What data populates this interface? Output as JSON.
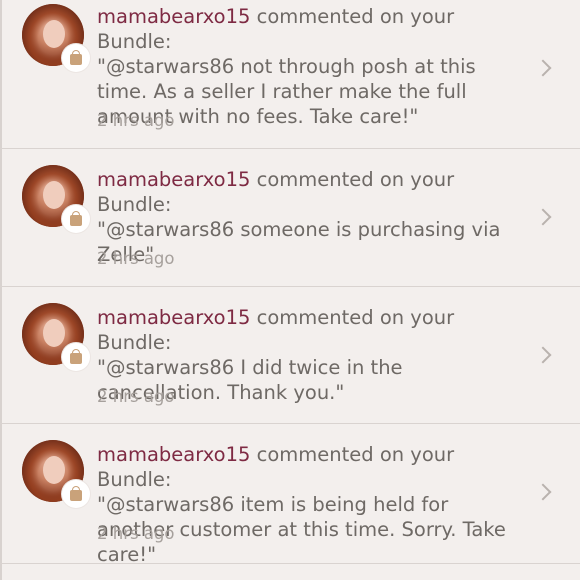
{
  "notifications": [
    {
      "username": "mamabearxo15",
      "action": " commented on your Bundle:",
      "comment": "\"@starwars86 not through posh at this time. As a seller I rather make the full amount with no fees. Take care!\"",
      "time": "2 hrs ago"
    },
    {
      "username": "mamabearxo15",
      "action": " commented on your Bundle:",
      "comment": "\"@starwars86 someone is purchasing via Zelle\"",
      "time": "2 hrs ago"
    },
    {
      "username": "mamabearxo15",
      "action": " commented on your Bundle:",
      "comment": "\"@starwars86 I did twice in the cancellation. Thank you.\"",
      "time": "2 hrs ago"
    },
    {
      "username": "mamabearxo15",
      "action": " commented on your Bundle:",
      "comment": "\"@starwars86 item is being held for another customer at this time. Sorry. Take care!\"",
      "time": "2 hrs ago"
    }
  ]
}
